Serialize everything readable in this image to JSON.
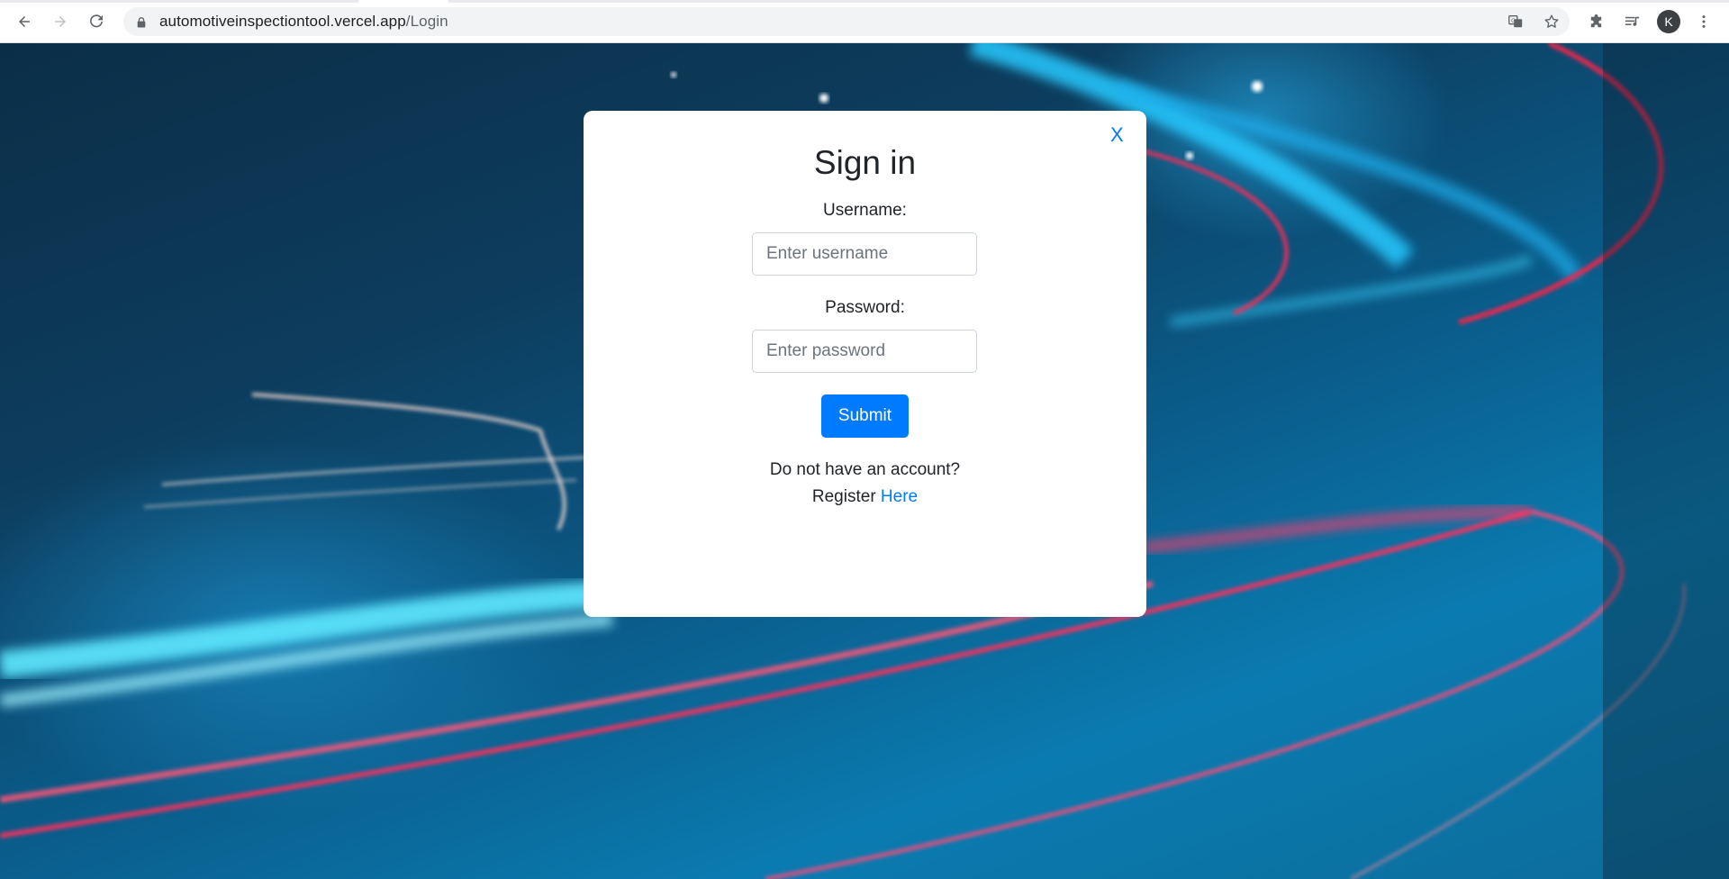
{
  "browser": {
    "url_domain": "automotiveinspectiontool.vercel.app",
    "url_path": "/Login",
    "profile_initial": "K"
  },
  "modal": {
    "close_label": "X",
    "title": "Sign in",
    "username_label": "Username:",
    "username_placeholder": "Enter username",
    "password_label": "Password:",
    "password_placeholder": "Enter password",
    "submit_label": "Submit",
    "no_account_text": "Do not have an account?",
    "register_text": "Register",
    "register_link": "Here"
  },
  "colors": {
    "accent": "#007bff",
    "text": "#212529"
  }
}
